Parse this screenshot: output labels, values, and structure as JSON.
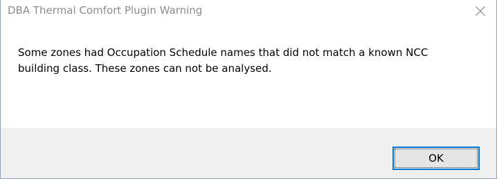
{
  "window": {
    "title": "DBA Thermal Comfort Plugin Warning",
    "close_icon": "close-icon"
  },
  "message": {
    "line1": "Some zones had Occupation Schedule names that did not match a known NCC",
    "line2": "building class.  These zones can not be analysed."
  },
  "buttons": {
    "ok_label": "OK"
  },
  "colors": {
    "accent": "#0078d7",
    "footer_bg": "#f0f0f0",
    "title_text": "#8c8c8c"
  }
}
